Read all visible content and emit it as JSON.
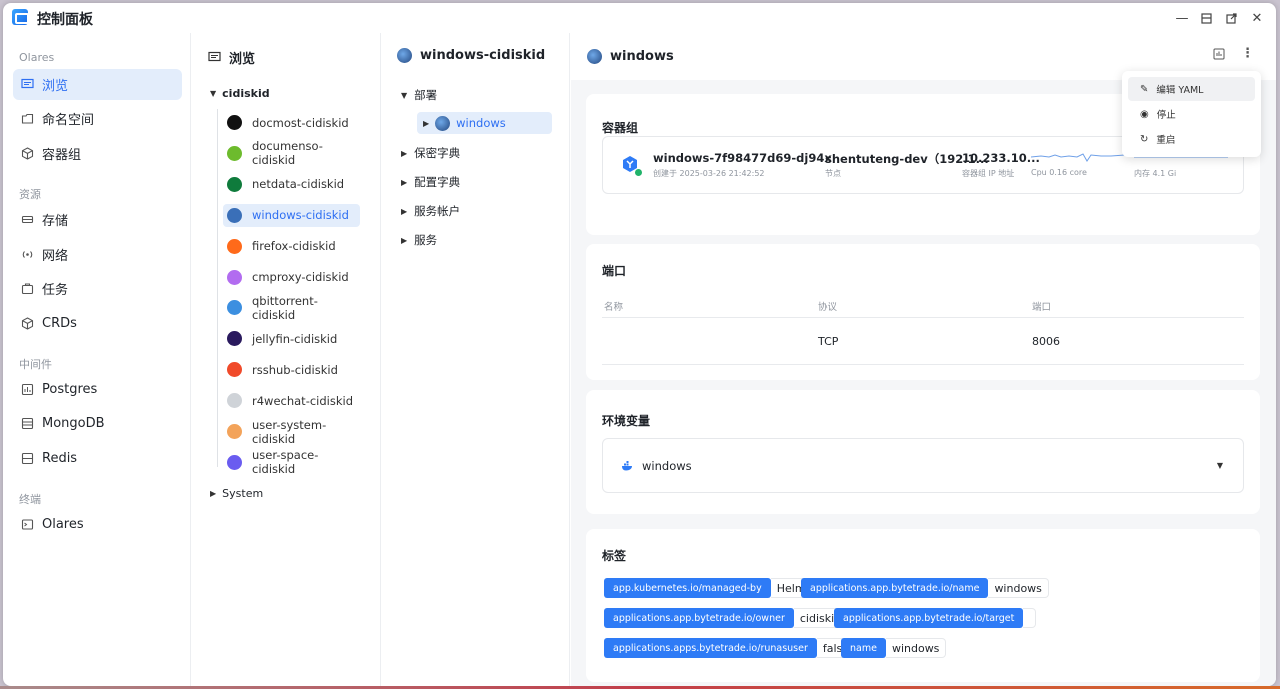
{
  "window": {
    "title": "控制面板"
  },
  "sidebar": {
    "groups": [
      {
        "label": "Olares",
        "items": [
          {
            "label": "浏览",
            "icon": "browse-icon"
          },
          {
            "label": "命名空间",
            "icon": "namespace-icon"
          },
          {
            "label": "容器组",
            "icon": "cube-icon"
          }
        ]
      },
      {
        "label": "资源",
        "items": [
          {
            "label": "存储",
            "icon": "storage-icon"
          },
          {
            "label": "网络",
            "icon": "network-icon"
          },
          {
            "label": "任务",
            "icon": "task-icon"
          },
          {
            "label": "CRDs",
            "icon": "cube-icon"
          }
        ]
      },
      {
        "label": "中间件",
        "items": [
          {
            "label": "Postgres",
            "icon": "database-icon"
          },
          {
            "label": "MongoDB",
            "icon": "database-icon"
          },
          {
            "label": "Redis",
            "icon": "database-icon"
          }
        ]
      },
      {
        "label": "终端",
        "items": [
          {
            "label": "Olares",
            "icon": "terminal-icon"
          }
        ]
      }
    ]
  },
  "browse": {
    "title": "浏览",
    "root": "cidiskid",
    "namespaces": [
      {
        "label": "docmost-cidiskid",
        "color": "#111111"
      },
      {
        "label": "documenso-cidiskid",
        "color": "#6dbb2d"
      },
      {
        "label": "netdata-cidiskid",
        "color": "#0f7b3c"
      },
      {
        "label": "windows-cidiskid",
        "color": "#3a6fb8"
      },
      {
        "label": "firefox-cidiskid",
        "color": "#ff6a1a"
      },
      {
        "label": "cmproxy-cidiskid",
        "color": "#b26cf0"
      },
      {
        "label": "qbittorrent-cidiskid",
        "color": "#3c8fe0"
      },
      {
        "label": "jellyfin-cidiskid",
        "color": "#2a1a5e"
      },
      {
        "label": "rsshub-cidiskid",
        "color": "#f04a2a"
      },
      {
        "label": "r4wechat-cidiskid",
        "color": "#cfd3d8"
      },
      {
        "label": "user-system-cidiskid",
        "color": "#f3a35a"
      },
      {
        "label": "user-space-cidiskid",
        "color": "#6a5cf0"
      }
    ],
    "system": "System"
  },
  "namespace": {
    "title": "windows-cidiskid",
    "deploy": "部署",
    "deploy_child": "windows",
    "others": [
      "保密字典",
      "配置字典",
      "服务帐户",
      "服务"
    ]
  },
  "detail": {
    "title": "windows",
    "pods": {
      "title": "容器组",
      "name": "windows-7f98477d69-dj94x",
      "created": "创建于 2025-03-26 21:42:52",
      "node": "shentuteng-dev（192.1...",
      "node_label": "节点",
      "ip": "10.233.10...",
      "ip_label": "容器组 IP 地址",
      "cpu_label": "Cpu 0.16 core",
      "mem_label": "内存 4.1 Gi"
    },
    "ports": {
      "title": "端口",
      "headers": [
        "名称",
        "协议",
        "端口"
      ],
      "rows": [
        {
          "name": "",
          "protocol": "TCP",
          "port": "8006"
        }
      ]
    },
    "env": {
      "title": "环境变量",
      "container": "windows"
    },
    "labels": {
      "title": "标签",
      "items": [
        {
          "key": "app.kubernetes.io/managed-by",
          "value": "Helm"
        },
        {
          "key": "applications.app.bytetrade.io/name",
          "value": "windows"
        },
        {
          "key": "applications.app.bytetrade.io/owner",
          "value": "cidiskid"
        },
        {
          "key": "applications.app.bytetrade.io/target",
          "value": ""
        },
        {
          "key": "applications.apps.bytetrade.io/runasuser",
          "value": "false"
        },
        {
          "key": "name",
          "value": "windows"
        }
      ]
    }
  },
  "menu": {
    "items": [
      "编辑 YAML",
      "停止",
      "重启"
    ]
  },
  "colors": {
    "accent": "#2e6ff2",
    "tag": "#2e7bf6",
    "running": "#21b36a"
  }
}
